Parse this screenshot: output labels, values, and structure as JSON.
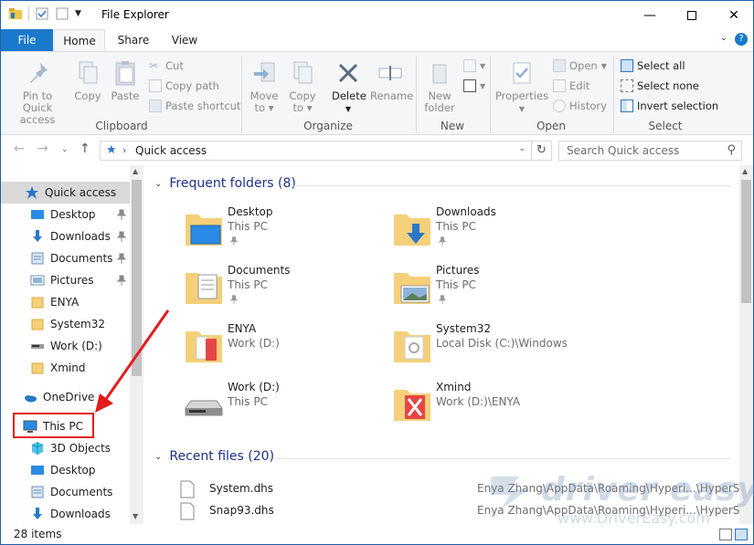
{
  "window": {
    "title": "File Explorer"
  },
  "ribbon": {
    "tabs": [
      {
        "label": "File",
        "active": false
      },
      {
        "label": "Home",
        "active": true
      },
      {
        "label": "Share",
        "active": false
      },
      {
        "label": "View",
        "active": false
      }
    ],
    "clipboard": {
      "label": "Clipboard",
      "pin": "Pin to Quick\naccess",
      "copy": "Copy",
      "paste": "Paste",
      "cut": "Cut",
      "copy_path": "Copy path",
      "paste_shortcut": "Paste shortcut"
    },
    "organize": {
      "label": "Organize",
      "move_to": "Move\nto",
      "copy_to": "Copy\nto",
      "delete": "Delete",
      "rename": "Rename"
    },
    "new": {
      "label": "New",
      "new_folder": "New\nfolder"
    },
    "open": {
      "label": "Open",
      "properties": "Properties",
      "open": "Open",
      "edit": "Edit",
      "history": "History"
    },
    "select": {
      "label": "Select",
      "select_all": "Select all",
      "select_none": "Select none",
      "invert": "Invert selection"
    }
  },
  "address": {
    "path": "Quick access",
    "search_placeholder": "Search Quick access"
  },
  "nav": {
    "items": [
      {
        "label": "Quick access",
        "icon": "star-icon",
        "pinned": false
      },
      {
        "label": "Desktop",
        "icon": "desktop-icon",
        "pinned": true
      },
      {
        "label": "Downloads",
        "icon": "downloads-icon",
        "pinned": true
      },
      {
        "label": "Documents",
        "icon": "documents-icon",
        "pinned": true
      },
      {
        "label": "Pictures",
        "icon": "pictures-icon",
        "pinned": true
      },
      {
        "label": "ENYA",
        "icon": "folder-icon",
        "pinned": false
      },
      {
        "label": "System32",
        "icon": "folder-icon",
        "pinned": false
      },
      {
        "label": "Work (D:)",
        "icon": "drive-icon",
        "pinned": false
      },
      {
        "label": "Xmind",
        "icon": "folder-icon",
        "pinned": false
      },
      {
        "label": "OneDrive",
        "icon": "onedrive-icon",
        "pinned": false
      },
      {
        "label": "This PC",
        "icon": "this-pc-icon",
        "pinned": false
      },
      {
        "label": "3D Objects",
        "icon": "3d-objects-icon",
        "pinned": false
      },
      {
        "label": "Desktop",
        "icon": "desktop-icon",
        "pinned": false
      },
      {
        "label": "Documents",
        "icon": "documents-icon",
        "pinned": false
      },
      {
        "label": "Downloads",
        "icon": "downloads-icon",
        "pinned": false
      }
    ]
  },
  "content": {
    "frequent_header": "Frequent folders (8)",
    "recent_header": "Recent files (20)",
    "folders": [
      {
        "name": "Desktop",
        "location": "This PC",
        "pinned": true
      },
      {
        "name": "Downloads",
        "location": "This PC",
        "pinned": true
      },
      {
        "name": "Documents",
        "location": "This PC",
        "pinned": true
      },
      {
        "name": "Pictures",
        "location": "This PC",
        "pinned": true
      },
      {
        "name": "ENYA",
        "location": "Work (D:)",
        "pinned": false
      },
      {
        "name": "System32",
        "location": "Local Disk (C:)\\Windows",
        "pinned": false
      },
      {
        "name": "Work (D:)",
        "location": "This PC",
        "pinned": false
      },
      {
        "name": "Xmind",
        "location": "Work (D:)\\ENYA",
        "pinned": false
      }
    ],
    "recent_files": [
      {
        "name": "System.dhs",
        "path": "Enya Zhang\\AppData\\Roaming\\Hyperi...\\HyperSnap"
      },
      {
        "name": "Snap93.dhs",
        "path": "Enya Zhang\\AppData\\Roaming\\Hyperi...\\HyperSnap"
      }
    ]
  },
  "status": {
    "count": "28 items"
  },
  "watermark": {
    "brand": "driver easy",
    "url": "www.DriverEasy.com"
  },
  "colors": {
    "accent": "#1979ca",
    "highlight": "#e21b1b",
    "selection": "#d9d9d9"
  }
}
